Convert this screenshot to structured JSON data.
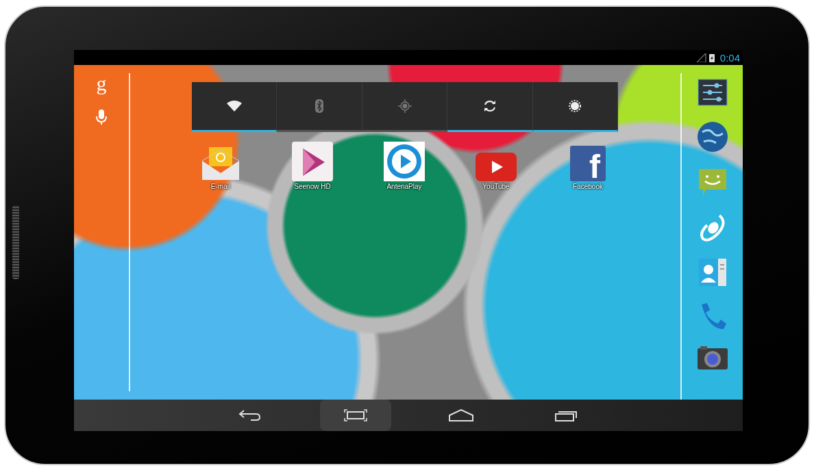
{
  "status_bar": {
    "time": "0:04"
  },
  "search_bar": {
    "glyph": "g"
  },
  "quick_settings": [
    {
      "kind": "wifi",
      "on": true
    },
    {
      "kind": "bluetooth",
      "on": false
    },
    {
      "kind": "location",
      "on": false
    },
    {
      "kind": "sync",
      "on": true
    },
    {
      "kind": "brightness",
      "on": true
    }
  ],
  "apps": [
    {
      "kind": "email",
      "label": "E-mail"
    },
    {
      "kind": "seenow",
      "label": "Seenow HD"
    },
    {
      "kind": "antenaplay",
      "label": "AntenaPlay"
    },
    {
      "kind": "youtube",
      "label": "YouTube"
    },
    {
      "kind": "facebook",
      "label": "Facebook",
      "glyph": "f"
    }
  ],
  "dock": [
    {
      "kind": "settings"
    },
    {
      "kind": "browser"
    },
    {
      "kind": "messaging"
    },
    {
      "kind": "swirl"
    },
    {
      "kind": "contacts"
    },
    {
      "kind": "phone"
    },
    {
      "kind": "camera"
    }
  ],
  "nav_buttons": [
    {
      "kind": "back",
      "selected": false
    },
    {
      "kind": "screenshot",
      "selected": true
    },
    {
      "kind": "home",
      "selected": false
    },
    {
      "kind": "recents",
      "selected": false
    }
  ]
}
